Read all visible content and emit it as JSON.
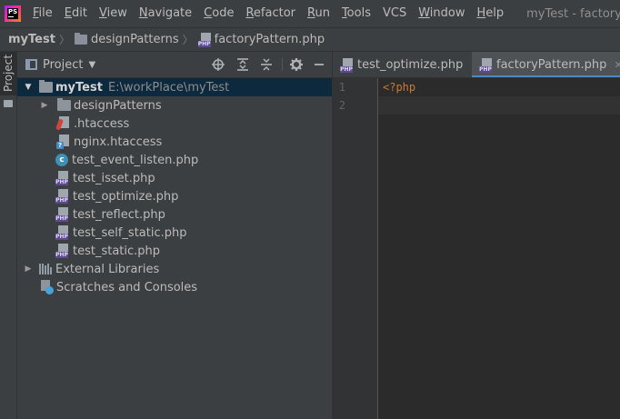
{
  "menubar": {
    "items": [
      {
        "first": "F",
        "rest": "ile"
      },
      {
        "first": "E",
        "rest": "dit"
      },
      {
        "first": "V",
        "rest": "iew"
      },
      {
        "first": "N",
        "rest": "avigate"
      },
      {
        "first": "C",
        "rest": "ode"
      },
      {
        "first": "R",
        "rest": "efactor"
      },
      {
        "first": "R",
        "rest": "un"
      },
      {
        "first": "T",
        "rest": "ools"
      },
      {
        "first": "",
        "rest": "VCS"
      },
      {
        "first": "W",
        "rest": "indow"
      },
      {
        "first": "H",
        "rest": "elp"
      }
    ],
    "window_title": "myTest - factoryPattern.php",
    "logo_text": "PS"
  },
  "breadcrumb": {
    "project": "myTest",
    "folder": "designPatterns",
    "file": "factoryPattern.php",
    "separator": "〉"
  },
  "side_stripe": {
    "project_tab": "Project"
  },
  "project_panel": {
    "title": "Project",
    "dropdown": "▼",
    "icons": [
      "locate-icon",
      "expand-all-icon",
      "collapse-all-icon",
      "gear-icon",
      "hide-icon"
    ],
    "tree": [
      {
        "label": "myTest",
        "path": "E:\\workPlace\\myTest",
        "arrow": "▼",
        "icon": "folder-icon"
      },
      {
        "label": "designPatterns",
        "arrow": "▶",
        "icon": "folder-icon"
      },
      {
        "label": ".htaccess",
        "icon": "htaccess-icon"
      },
      {
        "label": "nginx.htaccess",
        "icon": "htaccess-unknown-icon"
      },
      {
        "label": "test_event_listen.php",
        "icon": "php-class-icon",
        "class_letter": "c"
      },
      {
        "label": "test_isset.php",
        "icon": "php-file-icon"
      },
      {
        "label": "test_optimize.php",
        "icon": "php-file-icon"
      },
      {
        "label": "test_reflect.php",
        "icon": "php-file-icon"
      },
      {
        "label": "test_self_static.php",
        "icon": "php-file-icon"
      },
      {
        "label": "test_static.php",
        "icon": "php-file-icon"
      },
      {
        "label": "External Libraries",
        "arrow": "▶",
        "icon": "library-icon"
      },
      {
        "label": "Scratches and Consoles",
        "icon": "scratches-icon"
      }
    ]
  },
  "editor": {
    "tabs": [
      {
        "label": "test_optimize.php",
        "close": "✕",
        "active": false
      },
      {
        "label": "factoryPattern.php",
        "close": "✕",
        "active": true
      }
    ],
    "line_numbers": [
      "1",
      "2"
    ],
    "code_lines": [
      "<?php",
      ""
    ]
  },
  "php_badge": "PHP",
  "colors": {
    "background": "#2b2b2b",
    "panel": "#3c3f41",
    "selection": "#0d293e",
    "keyword": "#cc7832",
    "active_tab_underline": "#4a88c7"
  }
}
